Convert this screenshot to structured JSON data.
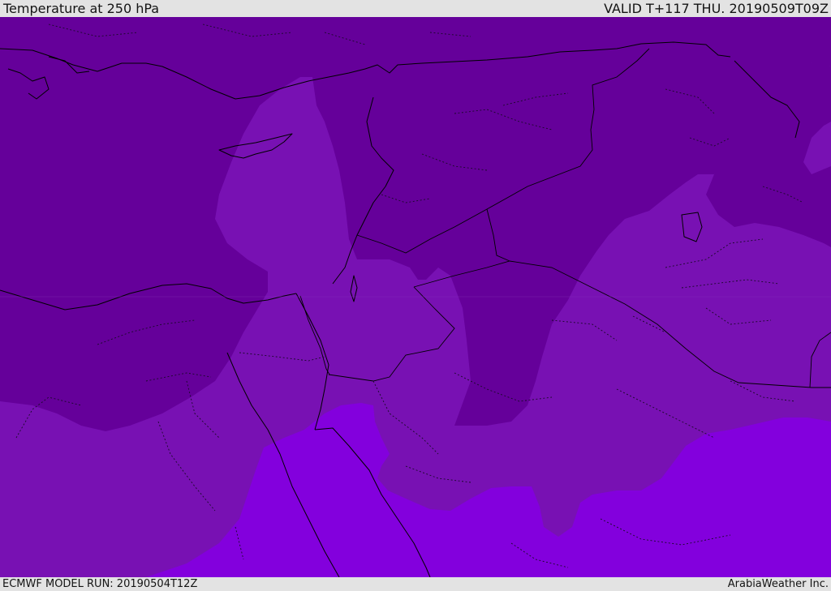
{
  "header": {
    "title": "Temperature at 250 hPa",
    "valid": "VALID T+117 THU. 20190509T09Z"
  },
  "footer": {
    "model_run": "ECMWF MODEL RUN: 20190504T12Z",
    "credit": "ArabiaWeather Inc."
  },
  "colors": {
    "cold_band": "#65009a",
    "mid_band": "#7811b3",
    "warm_band": "#8300dd",
    "frame": "#e3e3e3"
  }
}
